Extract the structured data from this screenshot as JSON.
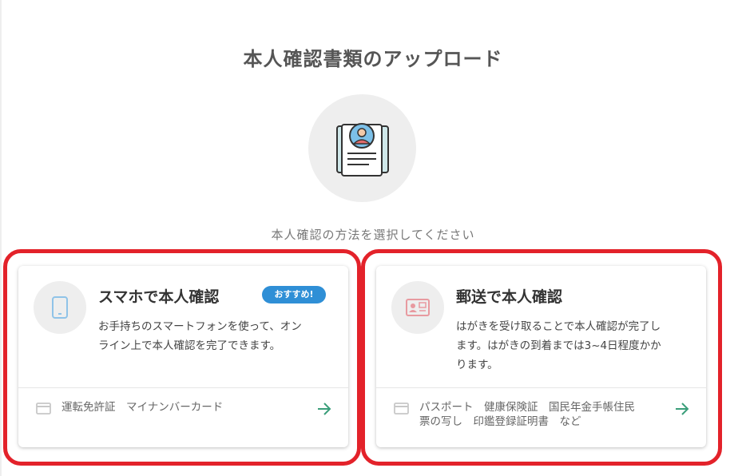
{
  "page": {
    "title": "本人確認書類のアップロード",
    "subtitle": "本人確認の方法を選択してください"
  },
  "icons": {
    "hero": "id-document-icon",
    "smartphone": "smartphone-icon",
    "mail_card": "mail-card-icon",
    "card": "credit-card-icon",
    "arrow": "arrow-right-icon"
  },
  "colors": {
    "highlight": "#e3222a",
    "badge": "#2f8fd6",
    "arrow": "#3a9e7a",
    "smartphone_icon": "#8fc3e8",
    "mail_icon": "#e89aa0"
  },
  "cards": [
    {
      "title": "スマホで本人確認",
      "badge": "おすすめ!",
      "desc_lines": [
        "お手持ちのスマートフォンを使って、オン",
        "ライン上で本人確認を完了できます。"
      ],
      "docs_lines": [
        "運転免許証　マイナンバーカード"
      ]
    },
    {
      "title": "郵送で本人確認",
      "desc_lines": [
        "はがきを受け取ることで本人確認が完了し",
        "ます。はがきの到着までは3~4日程度かか",
        "ります。"
      ],
      "docs_lines": [
        "パスポート　健康保険証　国民年金手帳住民",
        "票の写し　印鑑登録証明書　など"
      ]
    }
  ]
}
